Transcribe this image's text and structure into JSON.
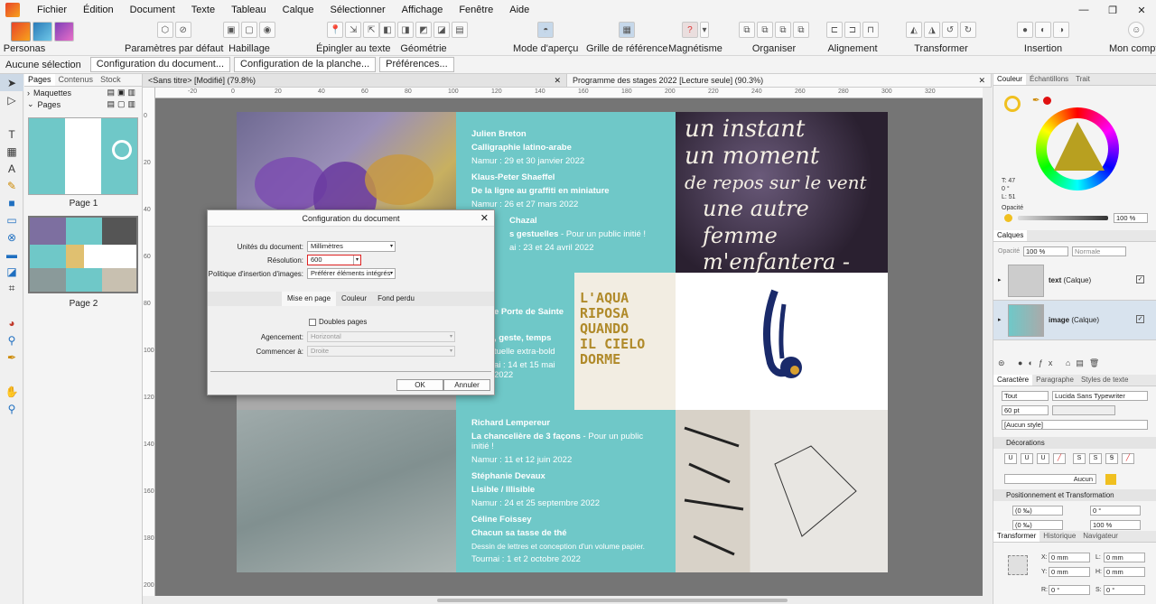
{
  "menu": [
    "Fichier",
    "Édition",
    "Document",
    "Texte",
    "Tableau",
    "Calque",
    "Sélectionner",
    "Affichage",
    "Fenêtre",
    "Aide"
  ],
  "toolbar": {
    "personas": "Personas",
    "params": "Paramètres par défaut",
    "habillage": "Habillage",
    "epingler": "Épingler au texte",
    "geometrie": "Géométrie",
    "apercu": "Mode d'aperçu",
    "grille": "Grille de référence",
    "magnetisme": "Magnétisme",
    "organiser": "Organiser",
    "alignement": "Alignement",
    "transformer": "Transformer",
    "insertion": "Insertion",
    "compte": "Mon compte"
  },
  "context": {
    "selection": "Aucune sélection",
    "config_doc": "Configuration du document...",
    "config_planche": "Configuration de la planche...",
    "prefs": "Préférences..."
  },
  "leftpanel": {
    "tabs": [
      "Pages",
      "Contenus",
      "Stock"
    ],
    "maquettes": "Maquettes",
    "pages": "Pages",
    "page1": "Page 1",
    "page2": "Page 2"
  },
  "doctabs": [
    {
      "label": "<Sans titre> [Modifié] (79.8%)",
      "close": "✕"
    },
    {
      "label": "Programme des stages 2022 [Lecture seule] (90.3%)",
      "close": "✕"
    }
  ],
  "ruler_h": [
    "-20",
    "0",
    "20",
    "40",
    "60",
    "80",
    "100",
    "120",
    "140",
    "160",
    "180",
    "200",
    "220",
    "240",
    "260",
    "280",
    "300",
    "320"
  ],
  "ruler_v": [
    "0",
    "20",
    "40",
    "60",
    "80",
    "100",
    "120",
    "140",
    "160",
    "180",
    "200"
  ],
  "document": {
    "block1": [
      {
        "name": "Julien Breton",
        "title": "Calligraphie latino-arabe",
        "date": "Namur : 29 et 30 janvier 2022"
      },
      {
        "name": "Klaus-Peter Shaeffel",
        "title": "De la ligne au graffiti en miniature",
        "date": "Namur : 26 et 27 mars 2022"
      },
      {
        "name": "Chazal",
        "title": "s gestuelles",
        "title_sub": " - Pour un public initié !",
        "date": "ai : 23 et 24 avril 2022"
      }
    ],
    "block2": [
      {
        "title": "e Porte de Sainte"
      },
      {
        "title": ", geste, temps"
      },
      {
        "title": "tuelle extra-bold"
      },
      {
        "title": "ai : 14 et 15 mai 2022"
      }
    ],
    "block3": [
      {
        "name": "Richard Lempereur",
        "title": "La chancelière de 3 façons",
        "title_sub": " - Pour un public initié !",
        "date": "Namur : 11 et 12 juin 2022"
      },
      {
        "name": "Stéphanie Devaux",
        "title": "Lisible / Illisible",
        "date": "Namur : 24 et 25 septembre 2022"
      },
      {
        "name": "Céline Foissey",
        "title": "Chacun sa tasse de thé",
        "desc": "Dessin de lettres et conception d'un volume papier.",
        "date": "Tournai : 1 et 2 octobre 2022"
      }
    ],
    "calligraphy": [
      "un instant",
      "un moment",
      "de repos sur le vent",
      "une autre femme",
      "m'enfantera -"
    ],
    "gold_text": [
      "L'AQUA",
      "RIPOSA",
      "QUANDO",
      "IL CIELO",
      "DORME"
    ]
  },
  "dialog": {
    "title": "Configuration du document",
    "close": "✕",
    "units_label": "Unités du document:",
    "units_value": "Millimètres",
    "res_label": "Résolution:",
    "res_value": "600",
    "policy_label": "Politique d'insertion d'images:",
    "policy_value": "Préférer éléments intégrés",
    "tabs": [
      "Mise en page",
      "Couleur",
      "Fond perdu"
    ],
    "double": "Doubles pages",
    "agencement_label": "Agencement:",
    "agencement_value": "Horizontal",
    "commencer_label": "Commencer à:",
    "commencer_value": "Droite",
    "ok": "OK",
    "cancel": "Annuler"
  },
  "right": {
    "color_tabs": [
      "Couleur",
      "Échantillons",
      "Trait"
    ],
    "t": "T: 47",
    "s": "0 °",
    "l": "L: 51",
    "opacite": "Opacité",
    "opacity_val": "100 %",
    "calques": "Calques",
    "opacite2": "Opacité",
    "op2_val": "100 %",
    "blend": "Normale",
    "layers": [
      {
        "name": "text",
        "type": " (Calque)"
      },
      {
        "name": "image",
        "type": " (Calque)"
      }
    ],
    "char_tabs": [
      "Caractère",
      "Paragraphe",
      "Styles de texte"
    ],
    "font_scope": "Tout",
    "font": "Lucida Sans Typewriter",
    "size": "60 pt",
    "style": "[Aucun style]",
    "decorations": "Décorations",
    "deco_none": "Aucun",
    "pos_title": "Positionnement et Transformation",
    "kern": "(0 ‰)",
    "track": "(0 ‰)",
    "t_val": "0 °",
    "scale_val": "100 %",
    "bottom_tabs": [
      "Transformer",
      "Historique",
      "Navigateur"
    ],
    "x": "0 mm",
    "y": "0 mm",
    "w": "0 mm",
    "h": "0 mm",
    "r": "0 °"
  },
  "colors": {
    "teal": "#6fc8c8",
    "accent": "#e8442a",
    "gold": "#b08a2a"
  }
}
